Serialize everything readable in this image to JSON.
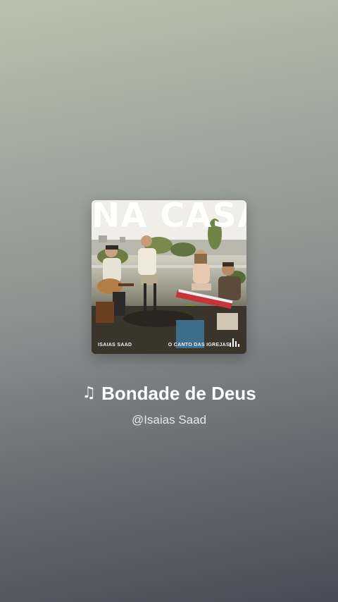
{
  "cover": {
    "headline": "NA CASA",
    "artist": "ISAIAS SAAD",
    "series": "O CANTO DAS IGREJAS",
    "logo": "bars-logo-icon"
  },
  "track": {
    "note_icon": "♫",
    "title": "Bondade de Deus",
    "artist_handle": "@Isaias Saad"
  },
  "colors": {
    "background_top": "#b9c2ad",
    "background_bottom": "#4b4b57",
    "text": "#ffffff"
  }
}
